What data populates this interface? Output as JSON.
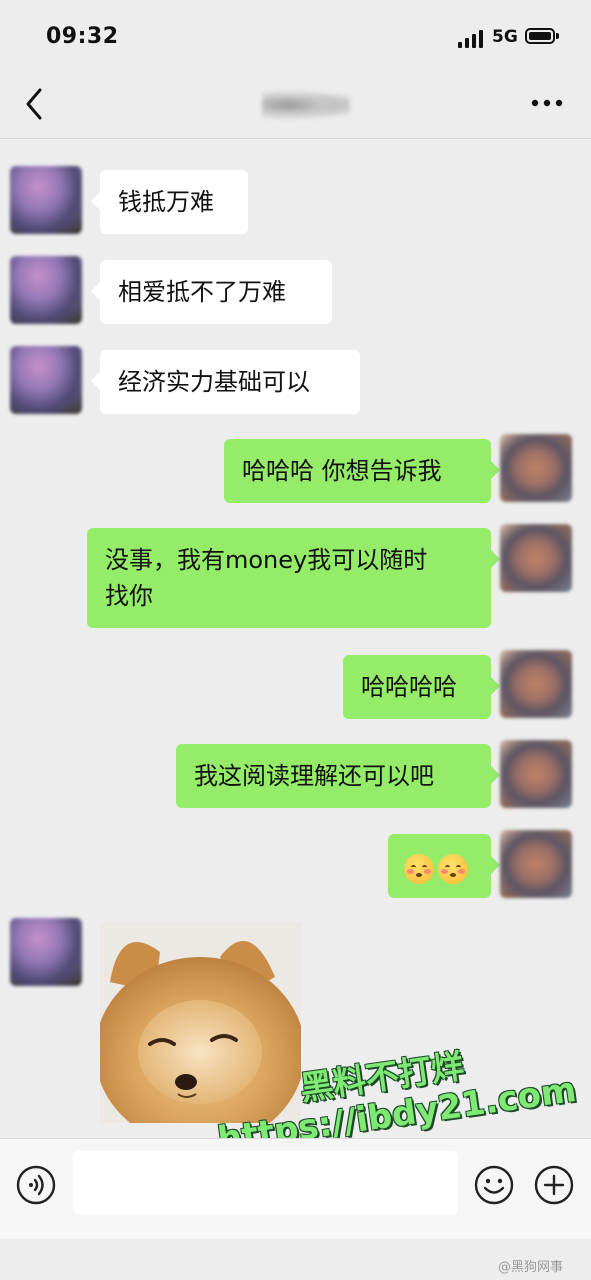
{
  "status_bar": {
    "time": "09:32",
    "network": "5G"
  },
  "nav": {
    "back_icon": "chevron-left-icon",
    "more_icon": "more-dots-icon"
  },
  "messages": [
    {
      "side": "left",
      "text": "钱抵万难"
    },
    {
      "side": "left",
      "text": "相爱抵不了万难"
    },
    {
      "side": "left",
      "text": "经济实力基础可以"
    },
    {
      "side": "right",
      "text": "哈哈哈 你想告诉我"
    },
    {
      "side": "right",
      "line1": "没事，我有money我可以随时",
      "line2": "找你"
    },
    {
      "side": "right",
      "text": "哈哈哈哈"
    },
    {
      "side": "right",
      "text": "我这阅读理解还可以吧"
    },
    {
      "side": "right",
      "emoji": "flushed-smile-emoji",
      "count": 2
    },
    {
      "side": "left",
      "image": "pomeranian-dog-sticker"
    }
  ],
  "input_bar": {
    "voice_icon": "voice-icon",
    "emoji_icon": "emoji-icon",
    "add_icon": "plus-icon"
  },
  "watermark": {
    "line1": "黑料不打烊",
    "line2": "https://ibdy21.com"
  },
  "credit": "@黑狗网事",
  "colors": {
    "sent_bubble": "#95ec69",
    "received_bubble": "#ffffff",
    "background": "#ededed"
  }
}
